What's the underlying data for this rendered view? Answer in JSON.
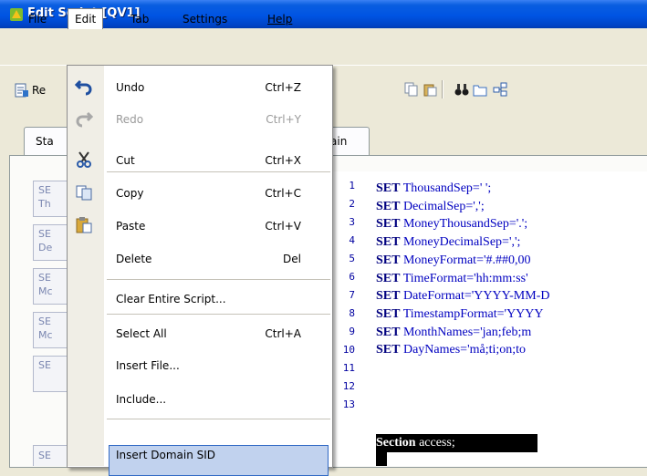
{
  "window": {
    "title": "Edit Script [QV1]"
  },
  "menubar": {
    "items": [
      "File",
      "Edit",
      "Tab",
      "Settings",
      "Help"
    ]
  },
  "toolbar": {
    "first_button_label": "Re"
  },
  "tabs": {
    "first_label_partial": "Sta",
    "main_label_partial": "ain"
  },
  "left_list": {
    "items": [
      {
        "title": "SE",
        "sub": "Th"
      },
      {
        "title": "SE",
        "sub": "De"
      },
      {
        "title": "SE",
        "sub": "Mc"
      },
      {
        "title": "SE",
        "sub": "Mc"
      },
      {
        "title": "SE",
        "sub": ""
      }
    ]
  },
  "edit_menu": {
    "items": [
      {
        "label": "Undo",
        "shortcut": "Ctrl+Z",
        "icon": "undo-icon",
        "enabled": true
      },
      {
        "label": "Redo",
        "shortcut": "Ctrl+Y",
        "icon": "redo-icon",
        "enabled": false
      },
      {
        "label": "Cut",
        "shortcut": "Ctrl+X",
        "icon": "scissors-icon",
        "enabled": true
      },
      {
        "label": "Copy",
        "shortcut": "Ctrl+C",
        "icon": "copy-icon",
        "enabled": true
      },
      {
        "label": "Paste",
        "shortcut": "Ctrl+V",
        "icon": "paste-icon",
        "enabled": true
      },
      {
        "label": "Delete",
        "shortcut": "Del",
        "icon": "",
        "enabled": true
      },
      {
        "label": "Clear Entire Script...",
        "shortcut": "",
        "icon": "",
        "enabled": true
      },
      {
        "label": "Select All",
        "shortcut": "Ctrl+A",
        "icon": "",
        "enabled": true
      },
      {
        "label": "Insert File...",
        "shortcut": "",
        "icon": "",
        "enabled": true
      },
      {
        "label": "Include...",
        "shortcut": "",
        "icon": "",
        "enabled": true
      },
      {
        "label": "Insert Domain SID",
        "shortcut": "",
        "icon": "",
        "enabled": true,
        "highlighted": true
      }
    ]
  },
  "editor": {
    "line_numbers": [
      "1",
      "2",
      "3",
      "4",
      "5",
      "6",
      "7",
      "8",
      "9",
      "10",
      "11",
      "12",
      "13"
    ],
    "lines": [
      {
        "kw": "SET",
        "text": " ThousandSep=' ';"
      },
      {
        "kw": "SET",
        "text": " DecimalSep=',';"
      },
      {
        "kw": "SET",
        "text": " MoneyThousandSep='.';"
      },
      {
        "kw": "SET",
        "text": " MoneyDecimalSep=',';"
      },
      {
        "kw": "SET",
        "text": " MoneyFormat='#.##0,00"
      },
      {
        "kw": "SET",
        "text": " TimeFormat='hh:mm:ss'"
      },
      {
        "kw": "SET",
        "text": " DateFormat='YYYY-MM-D"
      },
      {
        "kw": "SET",
        "text": " TimestampFormat='YYYY"
      },
      {
        "kw": "SET",
        "text": " MonthNames='jan;feb;m"
      },
      {
        "kw": "SET",
        "text": " DayNames='må;ti;on;to"
      }
    ],
    "selected_line": {
      "kw": "Section",
      "text": " access;"
    }
  },
  "colors": {
    "titlebar": "#0054e3",
    "highlight": "#c1d2ee",
    "keyword": "#00007f",
    "code": "#0000c0"
  }
}
